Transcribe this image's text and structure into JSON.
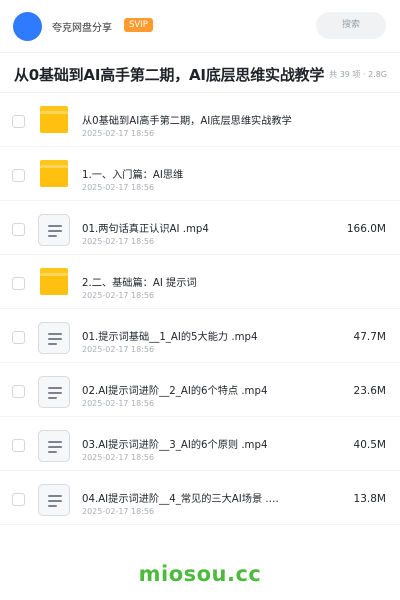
{
  "header": {
    "brand": "夸克网盘分享",
    "badge": "SVIP",
    "search_placeholder": "搜索"
  },
  "folder": {
    "title": "从0基础到AI高手第二期，AI底层思维实战教学",
    "meta": "共 39 项 · 2.8G"
  },
  "items": [
    {
      "type": "folder",
      "name": "从0基础到AI高手第二期，AI底层思维实战教学",
      "date": "2025-02-17 18:56",
      "size": ""
    },
    {
      "type": "folder",
      "name": "1.一、入门篇：AI思维",
      "date": "2025-02-17 18:56",
      "size": ""
    },
    {
      "type": "file",
      "name": "01.两句话真正认识AI .mp4",
      "date": "2025-02-17 18:56",
      "size": "166.0M"
    },
    {
      "type": "folder",
      "name": "2.二、基础篇：AI 提示词",
      "date": "2025-02-17 18:56",
      "size": ""
    },
    {
      "type": "file",
      "name": "01.提示词基础__1_AI的5大能力 .mp4",
      "date": "2025-02-17 18:56",
      "size": "47.7M"
    },
    {
      "type": "file",
      "name": "02.AI提示词进阶__2_AI的6个特点 .mp4",
      "date": "2025-02-17 18:56",
      "size": "23.6M"
    },
    {
      "type": "file",
      "name": "03.AI提示词进阶__3_AI的6个原则 .mp4",
      "date": "2025-02-17 18:56",
      "size": "40.5M"
    },
    {
      "type": "file",
      "name": "04.AI提示词进阶__4_常见的三大AI场景 .…",
      "date": "2025-02-17 18:56",
      "size": "13.8M"
    }
  ],
  "watermark": "miosou.cc",
  "colors": {
    "avatar": "#2f7bff",
    "badge": "#ff9a2e",
    "folder": "#ffc00f",
    "watermark": "#4cba3c"
  }
}
